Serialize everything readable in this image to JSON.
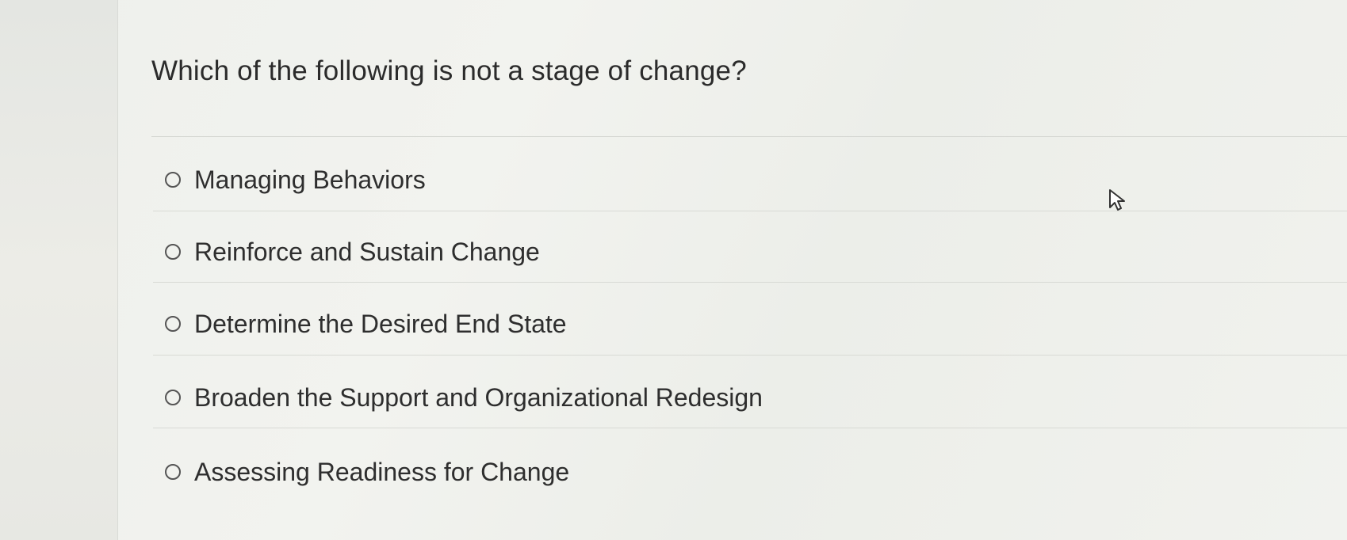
{
  "question": {
    "text": "Which of the following is not a stage of change?"
  },
  "options": [
    {
      "label": "Managing Behaviors",
      "selected": false
    },
    {
      "label": "Reinforce and Sustain Change",
      "selected": false
    },
    {
      "label": "Determine the Desired End State",
      "selected": false
    },
    {
      "label": "Broaden the Support and Organizational Redesign",
      "selected": false
    },
    {
      "label": "Assessing Readiness for Change",
      "selected": false
    }
  ],
  "icons": {
    "cursor": "mouse-pointer-icon",
    "radio": "radio-button-icon"
  }
}
